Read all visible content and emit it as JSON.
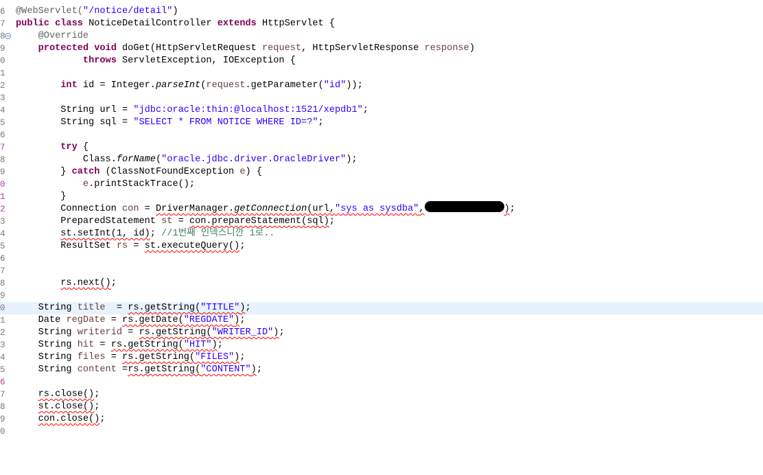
{
  "editor": {
    "line_numbers": [
      "6",
      "7",
      "8",
      "9",
      "0",
      "1",
      "2",
      "3",
      "4",
      "5",
      "6",
      "7",
      "8",
      "9",
      "0",
      "1",
      "2",
      "3",
      "4",
      "5",
      "6",
      "7",
      "8",
      "9",
      "0",
      "1",
      "2",
      "3",
      "4",
      "5",
      "6",
      "7",
      "8",
      "9",
      "0"
    ],
    "code": {
      "l6_ann": "@WebServlet(",
      "l6_str": "\"/notice/detail\"",
      "l6_end": ")",
      "l7_kw": "public class",
      "l7_mid": " NoticeDetailController ",
      "l7_kw2": "extends",
      "l7_end": " HttpServlet {",
      "l8_ann": "@Override",
      "l9_kw": "protected void",
      "l9_mid": " doGet(HttpServletRequest ",
      "l9_var1": "request",
      "l9_mid2": ", HttpServletResponse ",
      "l9_var2": "response",
      "l9_end": ")",
      "l10_kw": "throws",
      "l10_end": " ServletException, IOException {",
      "l12_kw": "int",
      "l12_mid": " id = Integer.",
      "l12_static": "parseInt",
      "l12_mid2": "(",
      "l12_var": "request",
      "l12_mid3": ".getParameter(",
      "l12_str": "\"id\"",
      "l12_end": "));",
      "l14_mid": "String url = ",
      "l14_str": "\"jdbc:oracle:thin:@localhost:1521/xepdb1\"",
      "l14_end": ";",
      "l15_mid": "String sql = ",
      "l15_str": "\"SELECT * FROM NOTICE WHERE ID=?\"",
      "l15_end": ";",
      "l17_kw": "try",
      "l17_end": " {",
      "l18_mid": "Class.",
      "l18_static": "forName",
      "l18_mid2": "(",
      "l18_str": "\"oracle.jdbc.driver.OracleDriver\"",
      "l18_end": ");",
      "l19_mid": "} ",
      "l19_kw": "catch",
      "l19_mid2": " (ClassNotFoundException ",
      "l19_var": "e",
      "l19_end": ") {",
      "l20_var": "e",
      "l20_end": ".printStackTrace();",
      "l21": "}",
      "l22_mid": "Connection ",
      "l22_var": "con",
      "l22_mid2": " = ",
      "l22_err1": "DriverManager.",
      "l22_static": "getConnection",
      "l22_err2": "(url,",
      "l22_str": "\"sys as sysdba\"",
      "l22_err3": ",",
      "l22_err4": ")",
      "l22_end": ";",
      "l23_mid": "PreparedStatement ",
      "l23_var": "st",
      "l23_mid2": " = ",
      "l23_err": "con.prepareStatement(sql)",
      "l23_end": ";",
      "l24_err": "st.setInt(1, id)",
      "l24_mid": "; ",
      "l24_cmt": "//1번째 인덱스니깐 1로..",
      "l25_mid": "ResultSet ",
      "l25_var": "rs",
      "l25_mid2": " = ",
      "l25_err": "st.executeQuery()",
      "l25_end": ";",
      "l28_err": "rs.next()",
      "l28_end": ";",
      "l30_mid": "String ",
      "l30_var": "title",
      "l30_mid2": "  = ",
      "l30_err": "rs.getString(",
      "l30_str": "\"TITLE\"",
      "l30_err2": ")",
      "l30_end": ";",
      "l31_mid": "Date ",
      "l31_var": "regDate",
      "l31_mid2": " = ",
      "l31_err": "rs.getDate(",
      "l31_str": "\"REGDATE\"",
      "l31_err2": ")",
      "l31_end": ";",
      "l32_mid": "String ",
      "l32_var": "writerid",
      "l32_mid2": " = ",
      "l32_err": "rs.getString(",
      "l32_str": "\"WRITER_ID\"",
      "l32_err2": ")",
      "l32_end": ";",
      "l33_mid": "String ",
      "l33_var": "hit",
      "l33_mid2": " = ",
      "l33_err": "rs.getString(",
      "l33_str": "\"HIT\"",
      "l33_err2": ")",
      "l33_end": ";",
      "l34_mid": "String ",
      "l34_var": "files",
      "l34_mid2": " = ",
      "l34_err": "rs.getString(",
      "l34_str": "\"FILES\"",
      "l34_err2": ")",
      "l34_end": ";",
      "l35_mid": "String ",
      "l35_var": "content",
      "l35_mid2": " =",
      "l35_err": "rs.getString(",
      "l35_str": "\"CONTENT\"",
      "l35_err2": ")",
      "l35_end": ";",
      "l37_err": "rs.close()",
      "l37_end": ";",
      "l38_err": "st.close()",
      "l38_end": ";",
      "l39_err": "con.close()",
      "l39_end": ";"
    }
  }
}
